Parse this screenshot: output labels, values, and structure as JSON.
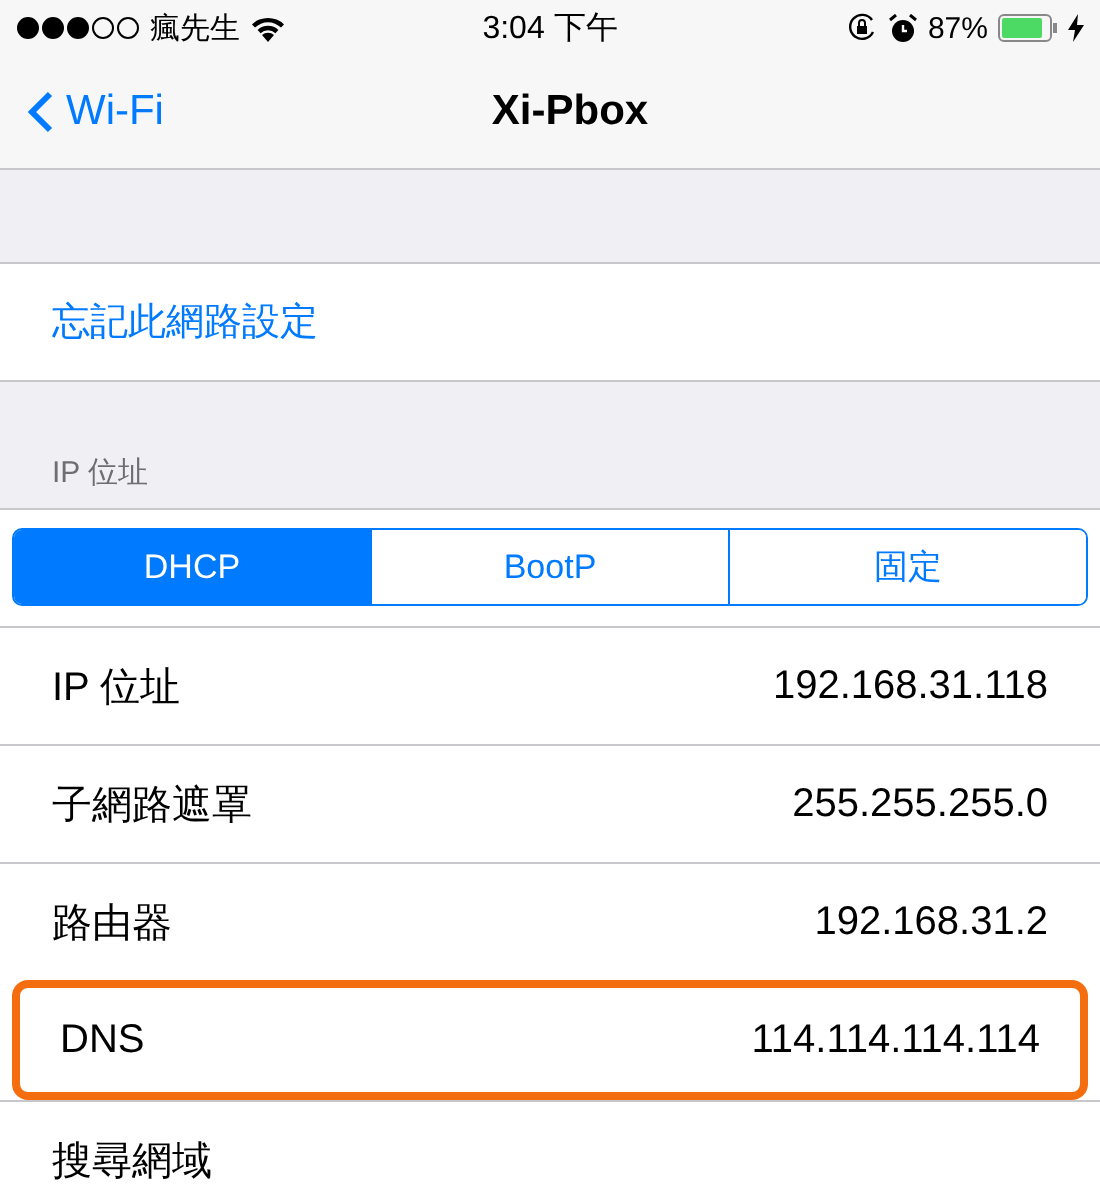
{
  "status_bar": {
    "carrier": "瘋先生",
    "time": "3:04 下午",
    "battery": "87%"
  },
  "nav": {
    "back": "Wi-Fi",
    "title": "Xi-Pbox"
  },
  "forget": {
    "label": "忘記此網路設定"
  },
  "section": {
    "header": "IP 位址"
  },
  "segments": [
    {
      "label": "DHCP",
      "selected": true
    },
    {
      "label": "BootP",
      "selected": false
    },
    {
      "label": "固定",
      "selected": false
    }
  ],
  "rows": [
    {
      "label": "IP 位址",
      "value": "192.168.31.118",
      "highlighted": false
    },
    {
      "label": "子網路遮罩",
      "value": "255.255.255.0",
      "highlighted": false
    },
    {
      "label": "路由器",
      "value": "192.168.31.2",
      "highlighted": false
    },
    {
      "label": "DNS",
      "value": "114.114.114.114",
      "highlighted": true
    },
    {
      "label": "搜尋網域",
      "highlighted": false
    }
  ]
}
